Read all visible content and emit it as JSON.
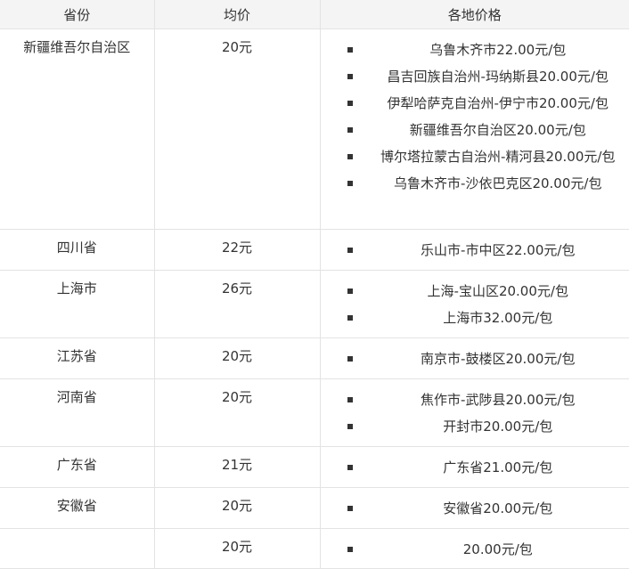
{
  "headers": [
    "省份",
    "均价",
    "各地价格"
  ],
  "rows": [
    {
      "province": "新疆维吾尔自治区",
      "avg": "20元",
      "prices": [
        "乌鲁木齐市22.00元/包",
        "昌吉回族自治州-玛纳斯县20.00元/包",
        "伊犁哈萨克自治州-伊宁市20.00元/包",
        "新疆维吾尔自治区20.00元/包",
        "博尔塔拉蒙古自治州-精河县20.00元/包",
        "乌鲁木齐市-沙依巴克区20.00元/包"
      ]
    },
    {
      "province": "四川省",
      "avg": "22元",
      "prices": [
        "乐山市-市中区22.00元/包"
      ]
    },
    {
      "province": "上海市",
      "avg": "26元",
      "prices": [
        "上海-宝山区20.00元/包",
        "上海市32.00元/包"
      ]
    },
    {
      "province": "江苏省",
      "avg": "20元",
      "prices": [
        "南京市-鼓楼区20.00元/包"
      ]
    },
    {
      "province": "河南省",
      "avg": "20元",
      "prices": [
        "焦作市-武陟县20.00元/包",
        "开封市20.00元/包"
      ]
    },
    {
      "province": "广东省",
      "avg": "21元",
      "prices": [
        "广东省21.00元/包"
      ]
    },
    {
      "province": "安徽省",
      "avg": "20元",
      "prices": [
        "安徽省20.00元/包"
      ]
    },
    {
      "province": "",
      "avg": "20元",
      "prices": [
        "20.00元/包"
      ]
    }
  ]
}
